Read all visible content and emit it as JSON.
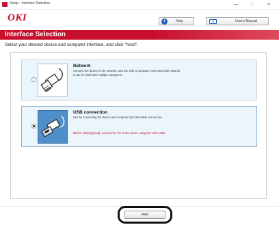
{
  "window": {
    "title": "Setup - Interface Selection",
    "min_label": "—",
    "max_label": "□",
    "close_label": "×"
  },
  "header": {
    "logo": "OKI",
    "help_label": "Help",
    "help_icon": "i",
    "manual_label": "User's Manual"
  },
  "banner": {
    "title": "Interface Selection"
  },
  "instruction": "Select your desired device and computer interface, and click \"Next\".",
  "options": [
    {
      "title": "Network",
      "desc1": "Connect the device to the network, and use with a computer connected with network.",
      "desc2": "It can be used with multiple computers.",
      "selected": false,
      "icon": "network-cable-icon"
    },
    {
      "title": "USB connection",
      "desc1": "Use by connecting the device and computer by USB cable one-to-one.",
      "note": "Before clicking [Next], connect the PC to the device using the USB cable.",
      "selected": true,
      "icon": "usb-cable-icon"
    }
  ],
  "footer": {
    "next_label": "Next"
  },
  "colors": {
    "brand_red": "#c8102e",
    "option_bg": "#eaf6fc",
    "usb_thumb": "#4f8fca"
  }
}
